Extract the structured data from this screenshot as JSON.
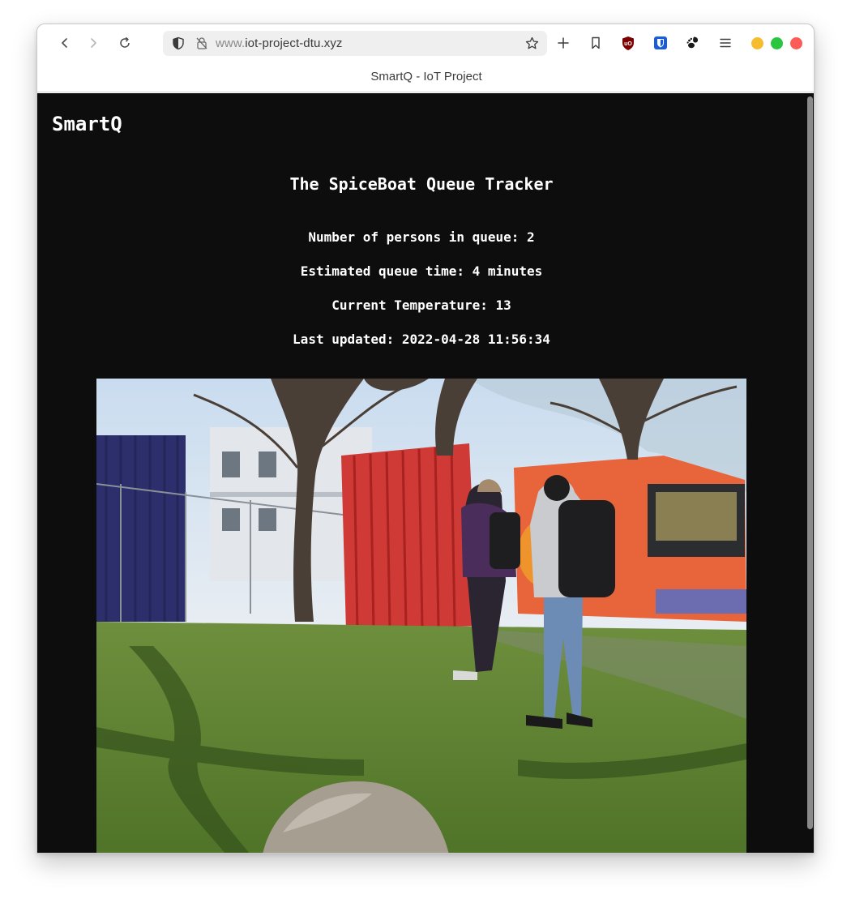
{
  "browser": {
    "url_prefix": "www.",
    "url_domain": "iot-project-dtu.xyz",
    "tab_title": "SmartQ - IoT Project",
    "icons": [
      "back-icon",
      "forward-icon",
      "reload-icon",
      "shield-icon",
      "tracking-lock-icon",
      "star-icon",
      "new-tab-icon",
      "bookmark-icon",
      "ublock-icon",
      "bitwarden-icon",
      "gnome-icon",
      "menu-icon"
    ],
    "traffic_colors": {
      "minimize": "#f5bd2e",
      "maximize": "#2bc63f",
      "close": "#fd5c56"
    }
  },
  "page": {
    "brand": "SmartQ",
    "heading": "The SpiceBoat Queue Tracker",
    "stats": {
      "persons": "Number of persons in queue: 2",
      "queue_time": "Estimated queue time: 4 minutes",
      "temperature": "Current Temperature: 13",
      "last_updated": "Last updated: 2022-04-28 11:56:34"
    },
    "colors": {
      "background": "#0d0d0d",
      "text": "#ffffff"
    }
  }
}
